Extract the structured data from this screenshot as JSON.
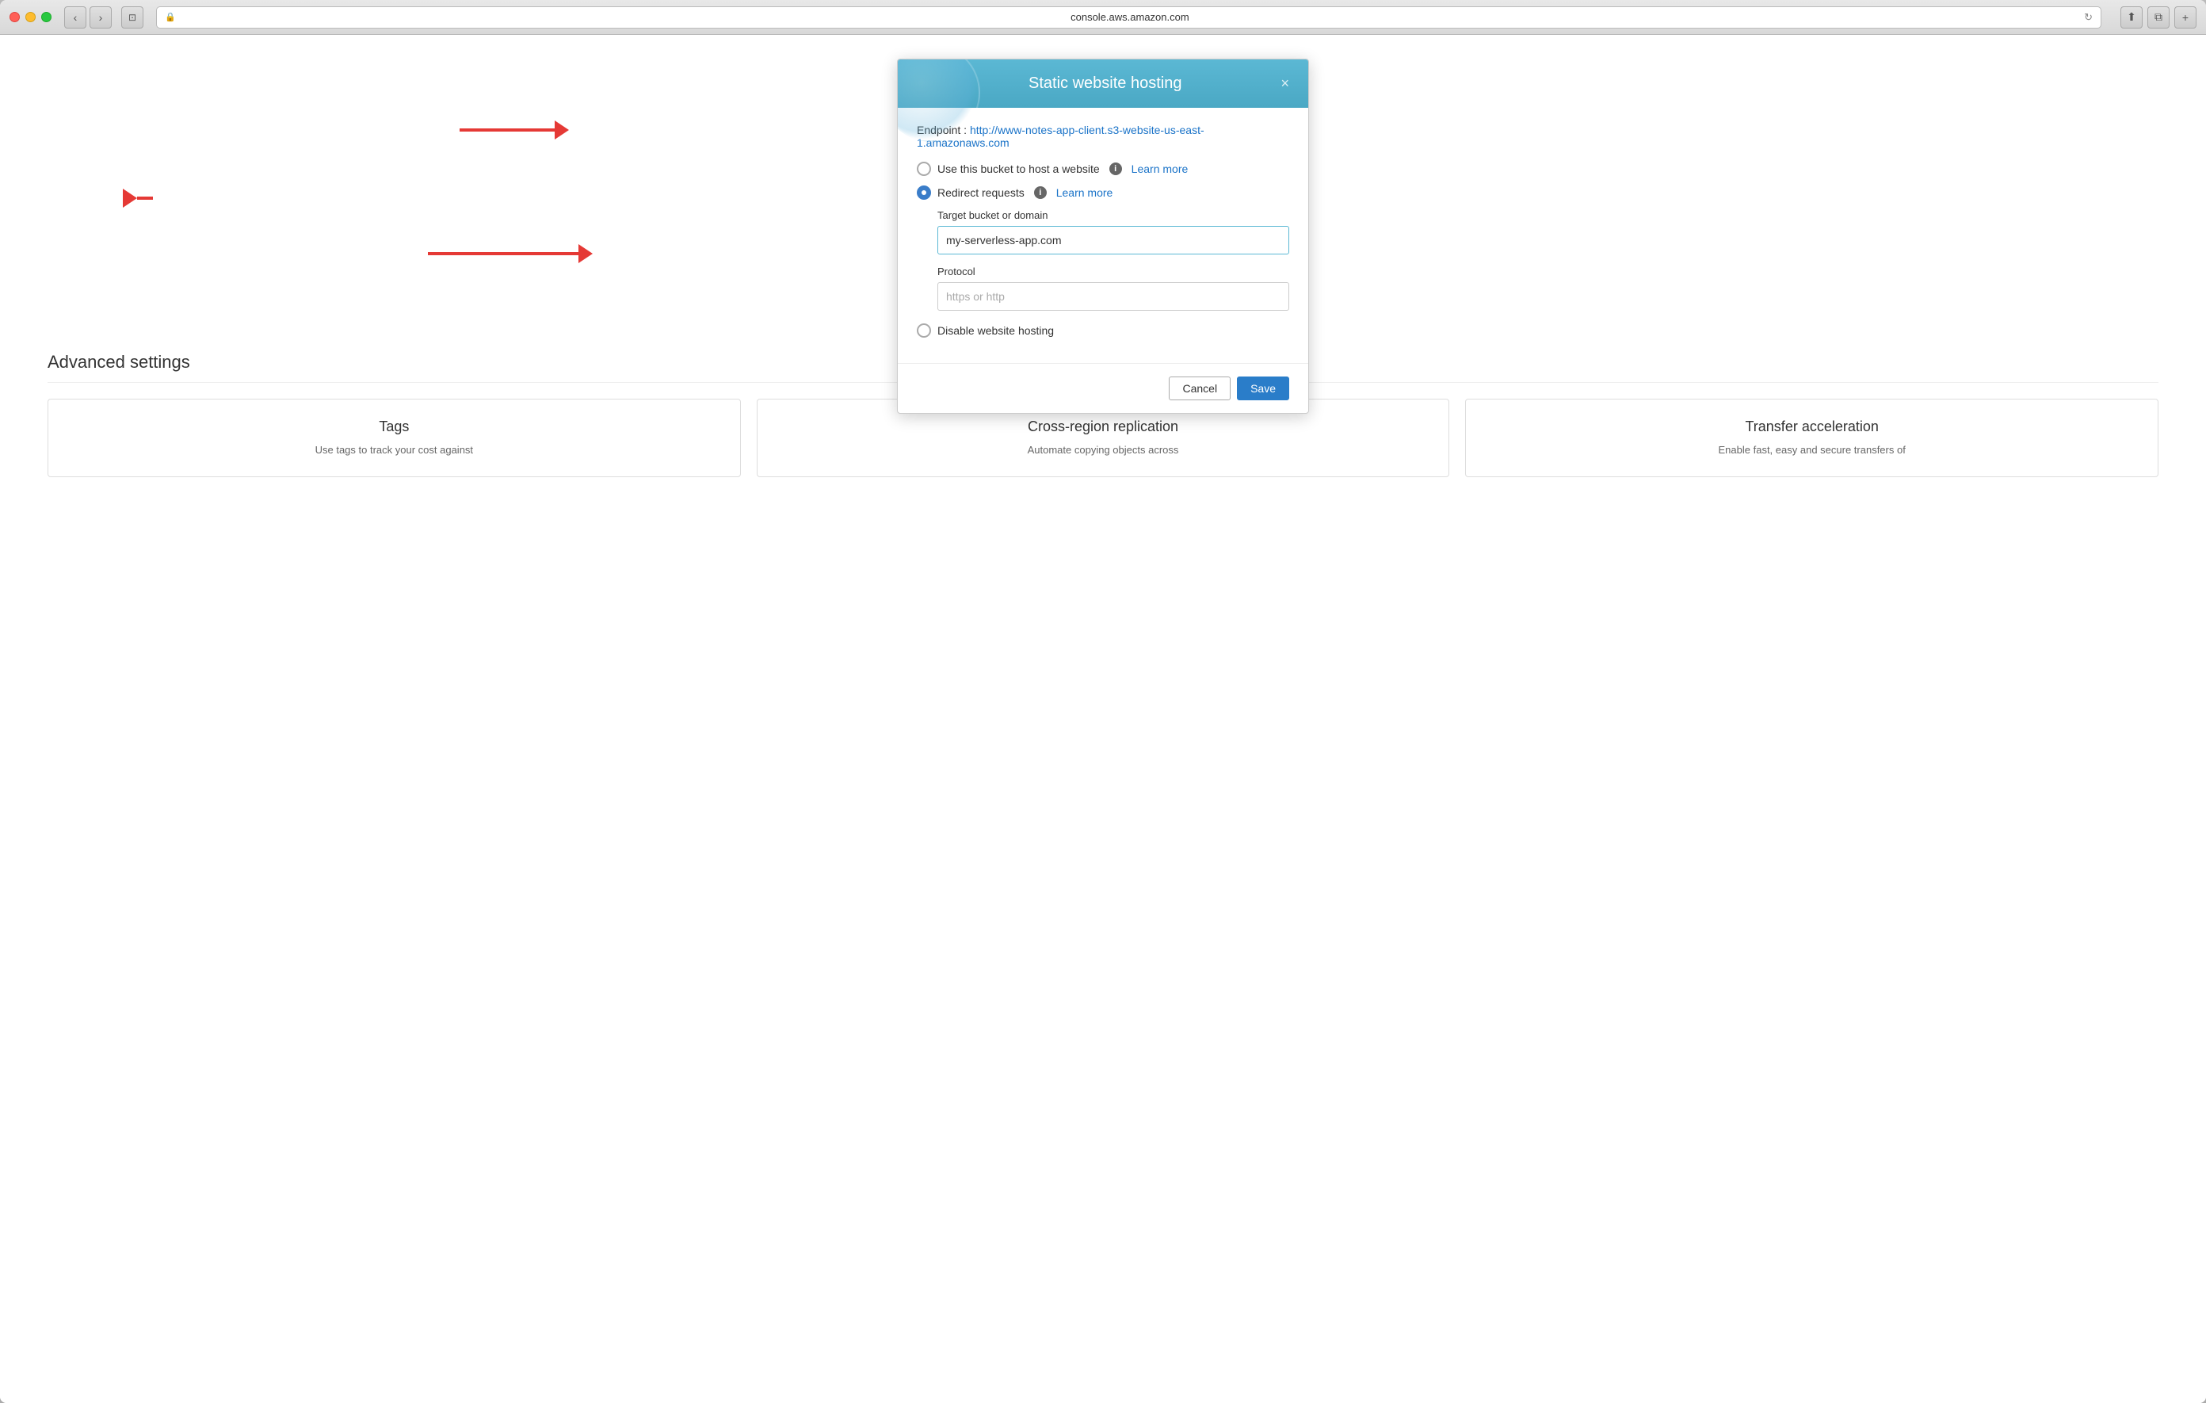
{
  "browser": {
    "url": "console.aws.amazon.com",
    "lock_icon": "🔒",
    "refresh_icon": "↻"
  },
  "dialog": {
    "title": "Static website hosting",
    "close_label": "×",
    "endpoint_label": "Endpoint :",
    "endpoint_url": "http://www-notes-app-client.s3-website-us-east-1.amazonaws.com",
    "radio_options": [
      {
        "id": "use-bucket",
        "label": "Use this bucket to host a website",
        "selected": false,
        "has_info": true,
        "has_learn_more": true,
        "learn_more_text": "Learn more"
      },
      {
        "id": "redirect-requests",
        "label": "Redirect requests",
        "selected": true,
        "has_info": true,
        "has_learn_more": true,
        "learn_more_text": "Learn more"
      },
      {
        "id": "disable-hosting",
        "label": "Disable website hosting",
        "selected": false,
        "has_info": false,
        "has_learn_more": false
      }
    ],
    "target_bucket_label": "Target bucket or domain",
    "target_bucket_value": "my-serverless-app.com",
    "protocol_label": "Protocol",
    "protocol_placeholder": "https or http",
    "cancel_label": "Cancel",
    "save_label": "Save"
  },
  "advanced_settings": {
    "title": "Advanced settings",
    "cards": [
      {
        "title": "Tags",
        "description": "Use tags to track your cost against"
      },
      {
        "title": "Cross-region replication",
        "description": "Automate copying objects across"
      },
      {
        "title": "Transfer acceleration",
        "description": "Enable fast, easy and secure transfers of"
      }
    ]
  }
}
